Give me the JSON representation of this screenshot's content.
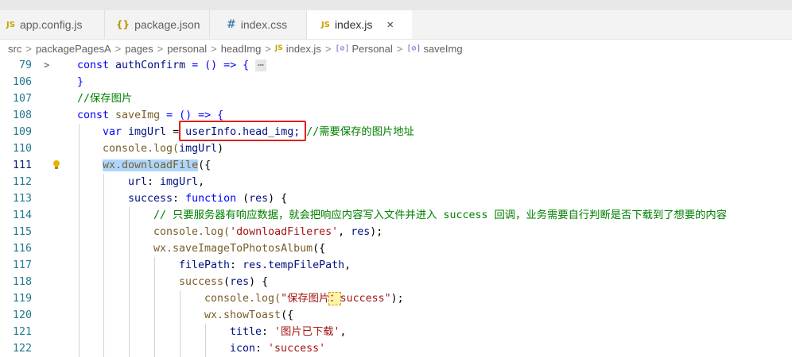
{
  "tabs": [
    {
      "icon": "JS",
      "label": "app.config.js"
    },
    {
      "icon": "{}",
      "label": "package.json"
    },
    {
      "icon": "#",
      "label": "index.css"
    },
    {
      "icon": "JS",
      "label": "index.js",
      "close": "×"
    }
  ],
  "breadcrumb": {
    "items": [
      "src",
      "packagePagesA",
      "pages",
      "personal",
      "headImg"
    ],
    "file_icon": "JS",
    "file": "index.js",
    "symbol_icon": "[⊘]",
    "symbols": [
      "Personal",
      "saveImg"
    ],
    "separator": ">"
  },
  "editor": {
    "lines": [
      {
        "n": "79",
        "fold": ">",
        "t": [
          "const ",
          "authConfirm",
          " = () => { ",
          "⋯"
        ]
      },
      {
        "n": "106",
        "t": [
          "}"
        ]
      },
      {
        "n": "107",
        "t": [
          "//保存图片"
        ]
      },
      {
        "n": "108",
        "t": [
          "const ",
          "saveImg",
          " = () => {"
        ]
      },
      {
        "n": "109",
        "t": [
          "var ",
          "imgUrl",
          " = ",
          "userInfo.head_img;",
          " ",
          "//需要保存的图片地址"
        ]
      },
      {
        "n": "110",
        "t": [
          "console.log(",
          "imgUrl",
          ")"
        ]
      },
      {
        "n": "111",
        "t": [
          "wx.downloadFile",
          "({"
        ]
      },
      {
        "n": "112",
        "t": [
          "url",
          ": ",
          "imgUrl",
          ","
        ]
      },
      {
        "n": "113",
        "t": [
          "success",
          ": ",
          "function",
          " (",
          "res",
          ") {"
        ]
      },
      {
        "n": "114",
        "t": [
          "// 只要服务器有响应数据，就会把响应内容写入文件并进入 success 回调，业务需要自行判断是否下载到了想要的内容"
        ]
      },
      {
        "n": "115",
        "t": [
          "console.log(",
          "'downloadFileres'",
          ", ",
          "res",
          ");"
        ]
      },
      {
        "n": "116",
        "t": [
          "wx.saveImageToPhotosAlbum",
          "({"
        ]
      },
      {
        "n": "117",
        "t": [
          "filePath",
          ": ",
          "res.tempFilePath",
          ","
        ]
      },
      {
        "n": "118",
        "t": [
          "success",
          "(",
          "res",
          ") {"
        ]
      },
      {
        "n": "119",
        "t": [
          "console.log(",
          "\"保存图片",
          "：",
          "success\"",
          ");"
        ]
      },
      {
        "n": "120",
        "t": [
          "wx.showToast",
          "({"
        ]
      },
      {
        "n": "121",
        "t": [
          "title",
          ": ",
          "'图片已下载'",
          ","
        ]
      },
      {
        "n": "122",
        "t": [
          "icon",
          ": ",
          "'success'"
        ]
      }
    ]
  },
  "colors": {
    "keyword": "#0000ff",
    "string": "#a31515",
    "comment": "#008000",
    "variable": "#001080",
    "function": "#795e26",
    "highlight_box": "#e0201c"
  }
}
